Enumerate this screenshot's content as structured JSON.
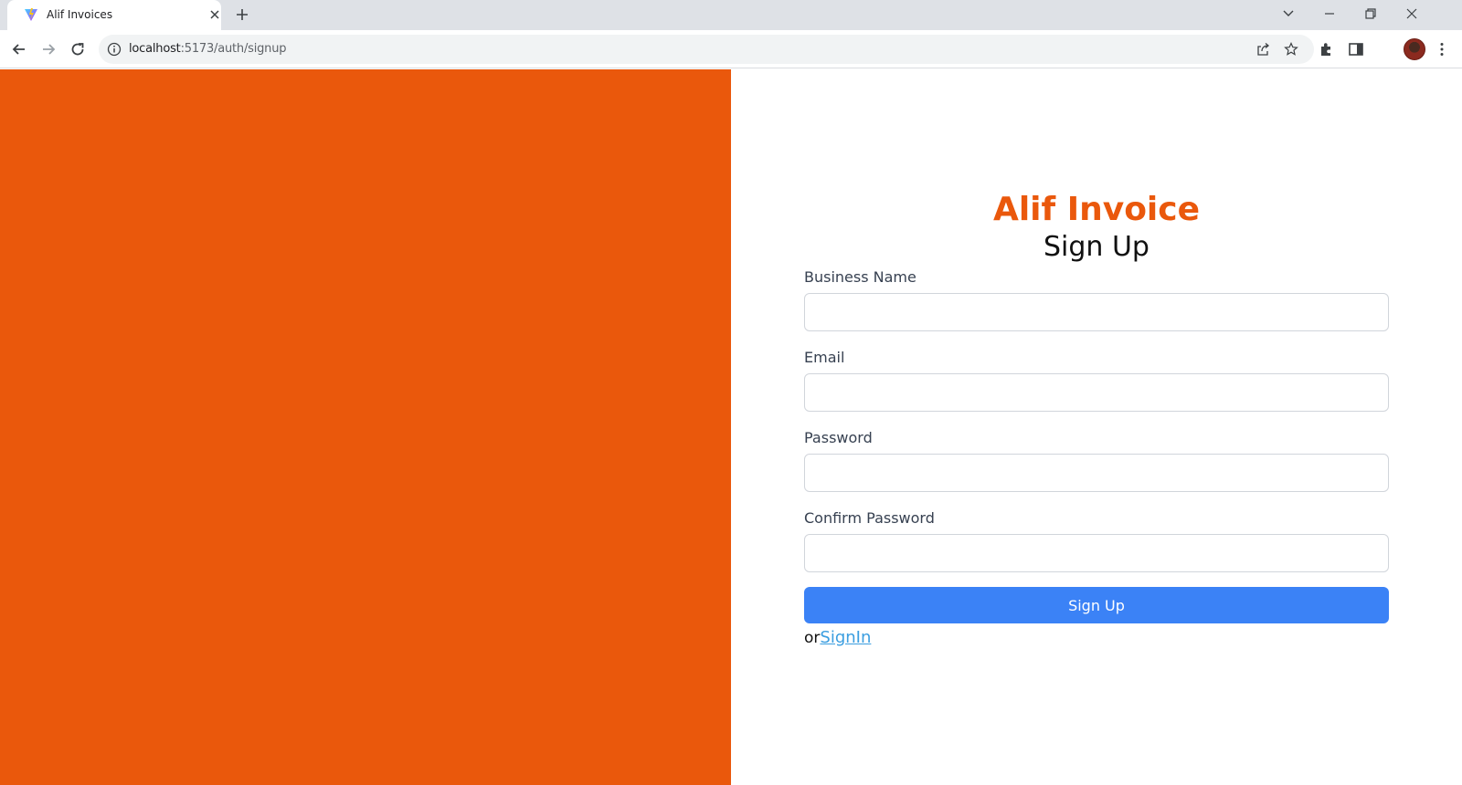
{
  "browser": {
    "tab_title": "Alif Invoices",
    "url_host": "localhost",
    "url_rest": ":5173/auth/signup"
  },
  "page": {
    "brand": "Alif Invoice",
    "heading": "Sign Up",
    "fields": [
      {
        "label": "Business Name",
        "value": "",
        "placeholder": ""
      },
      {
        "label": "Email",
        "value": "",
        "placeholder": ""
      },
      {
        "label": "Password",
        "value": "",
        "placeholder": ""
      },
      {
        "label": "Confirm Password",
        "value": "",
        "placeholder": ""
      }
    ],
    "submit_label": "Sign Up",
    "alt_prefix": "or",
    "alt_link": "SignIn",
    "colors": {
      "accent": "#ea580c",
      "button": "#3b82f6",
      "link": "#3b9ee0"
    }
  }
}
